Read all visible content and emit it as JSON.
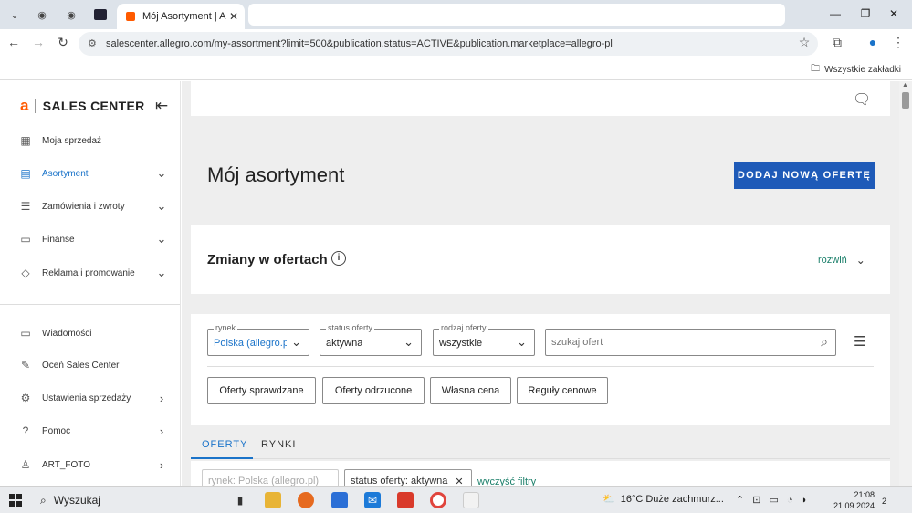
{
  "browser": {
    "tabs": [
      {
        "icon": "globe-icon"
      },
      {
        "icon": "globe-icon"
      },
      {
        "icon": "app-icon"
      }
    ],
    "active_tab_title": "Mój Asortyment | Allegro",
    "active_tab_close": "✕",
    "url": "salescenter.allegro.com/my-assortment?limit=500&publication.status=ACTIVE&publication.marketplace=allegro-pl",
    "bookmarks_label": "Wszystkie zakładki"
  },
  "sidebar": {
    "brand_a": "a",
    "brand": "SALES CENTER",
    "items_top": [
      {
        "label": "Moja sprzedaż",
        "icon": "grid-icon",
        "chevron": false
      },
      {
        "label": "Asortyment",
        "icon": "catalog-icon",
        "chevron": true,
        "active": true
      },
      {
        "label": "Zamówienia i zwroty",
        "icon": "orders-icon",
        "chevron": true
      },
      {
        "label": "Finanse",
        "icon": "finance-icon",
        "chevron": true
      },
      {
        "label": "Reklama i promowanie",
        "icon": "tag-icon",
        "chevron": true
      }
    ],
    "items_bottom": [
      {
        "label": "Wiadomości",
        "icon": "chat-icon"
      },
      {
        "label": "Oceń Sales Center",
        "icon": "edit-icon"
      },
      {
        "label": "Ustawienia sprzedaży",
        "icon": "gear-icon"
      },
      {
        "label": "Pomoc",
        "icon": "help-icon"
      },
      {
        "label": "ART_FOTO",
        "icon": "user-icon"
      }
    ]
  },
  "main": {
    "title": "Mój asortyment",
    "add_offer_button": "DODAJ NOWĄ OFERTĘ",
    "changes_title": "Zmiany w ofertach",
    "expand_label": "rozwiń",
    "filters": {
      "market": {
        "legend": "rynek",
        "value": "Polska (allegro.pl)"
      },
      "status": {
        "legend": "status oferty",
        "value": "aktywna"
      },
      "type": {
        "legend": "rodzaj oferty",
        "value": "wszystkie"
      },
      "search_placeholder": "szukaj ofert"
    },
    "quick_buttons": [
      "Oferty sprawdzane",
      "Oferty odrzucone",
      "Własna cena",
      "Reguły cenowe"
    ],
    "tabs": [
      "OFERTY",
      "RYNKI"
    ],
    "chips": [
      "rynek: Polska (allegro.pl)",
      "status oferty: aktywna"
    ],
    "clear_filters": "wyczyść filtry"
  },
  "taskbar": {
    "search_label": "Wyszukaj",
    "weather": "16°C  Duże zachmurz...",
    "time": "21:08",
    "date": "21.09.2024",
    "notification_count": "2"
  },
  "colors": {
    "accent": "#1e5ab8",
    "brand": "#ff5a00",
    "link": "#1b7f6a"
  }
}
